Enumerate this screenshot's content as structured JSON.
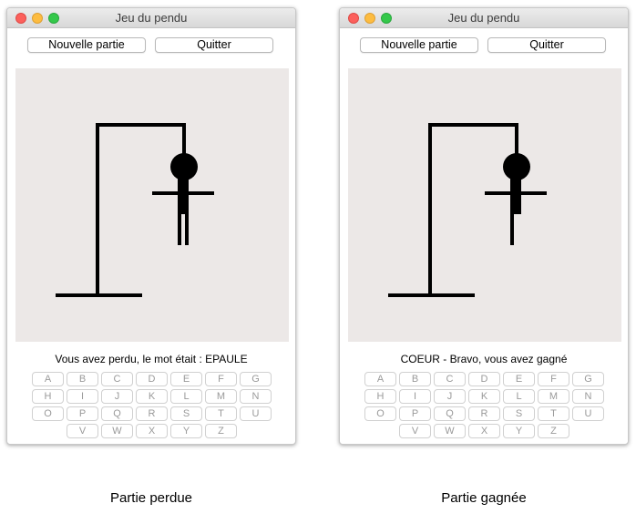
{
  "windows": [
    {
      "title": "Jeu du pendu",
      "buttons": {
        "new_game": "Nouvelle partie",
        "quit": "Quitter"
      },
      "status": "Vous avez perdu, le mot était : EPAULE",
      "hangman": {
        "state": "complete",
        "legs": "both"
      }
    },
    {
      "title": "Jeu du pendu",
      "buttons": {
        "new_game": "Nouvelle partie",
        "quit": "Quitter"
      },
      "status": "COEUR - Bravo, vous avez gagné",
      "hangman": {
        "state": "partial",
        "legs": "one"
      }
    }
  ],
  "keyboard": {
    "rows": [
      [
        "A",
        "B",
        "C",
        "D",
        "E",
        "F",
        "G"
      ],
      [
        "H",
        "I",
        "J",
        "K",
        "L",
        "M",
        "N"
      ],
      [
        "O",
        "P",
        "Q",
        "R",
        "S",
        "T",
        "U"
      ],
      [
        "V",
        "W",
        "X",
        "Y",
        "Z"
      ]
    ]
  },
  "captions": [
    "Partie perdue",
    "Partie gagnée"
  ],
  "colors": {
    "canvas_bg": "#ece8e7",
    "drawing": "#000000",
    "key_text": "#9a9a9a"
  }
}
